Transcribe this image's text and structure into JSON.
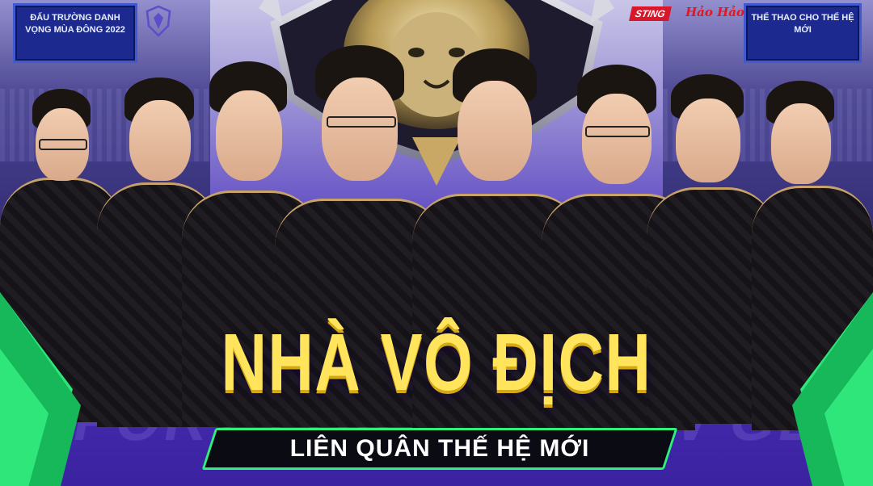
{
  "signs": {
    "left_text": "ĐẤU TRƯỜNG DANH VỌNG MÙA ĐÔNG 2022",
    "right_text": "THỂ THAO CHO THẾ HỆ MỚI"
  },
  "sponsors": {
    "sting": "STING",
    "haohao": "Hảo Hảo"
  },
  "background_slogan": "SPORT FOR THE NEW GENERATION",
  "headline": "NHÀ VÔ ĐỊCH",
  "subheadline": "LIÊN QUÂN THẾ HỆ MỚI",
  "colors": {
    "headline": "#ffe45c",
    "accent_green": "#2ef07a",
    "background_purple": "#4a2fb5"
  },
  "players_count": 8
}
